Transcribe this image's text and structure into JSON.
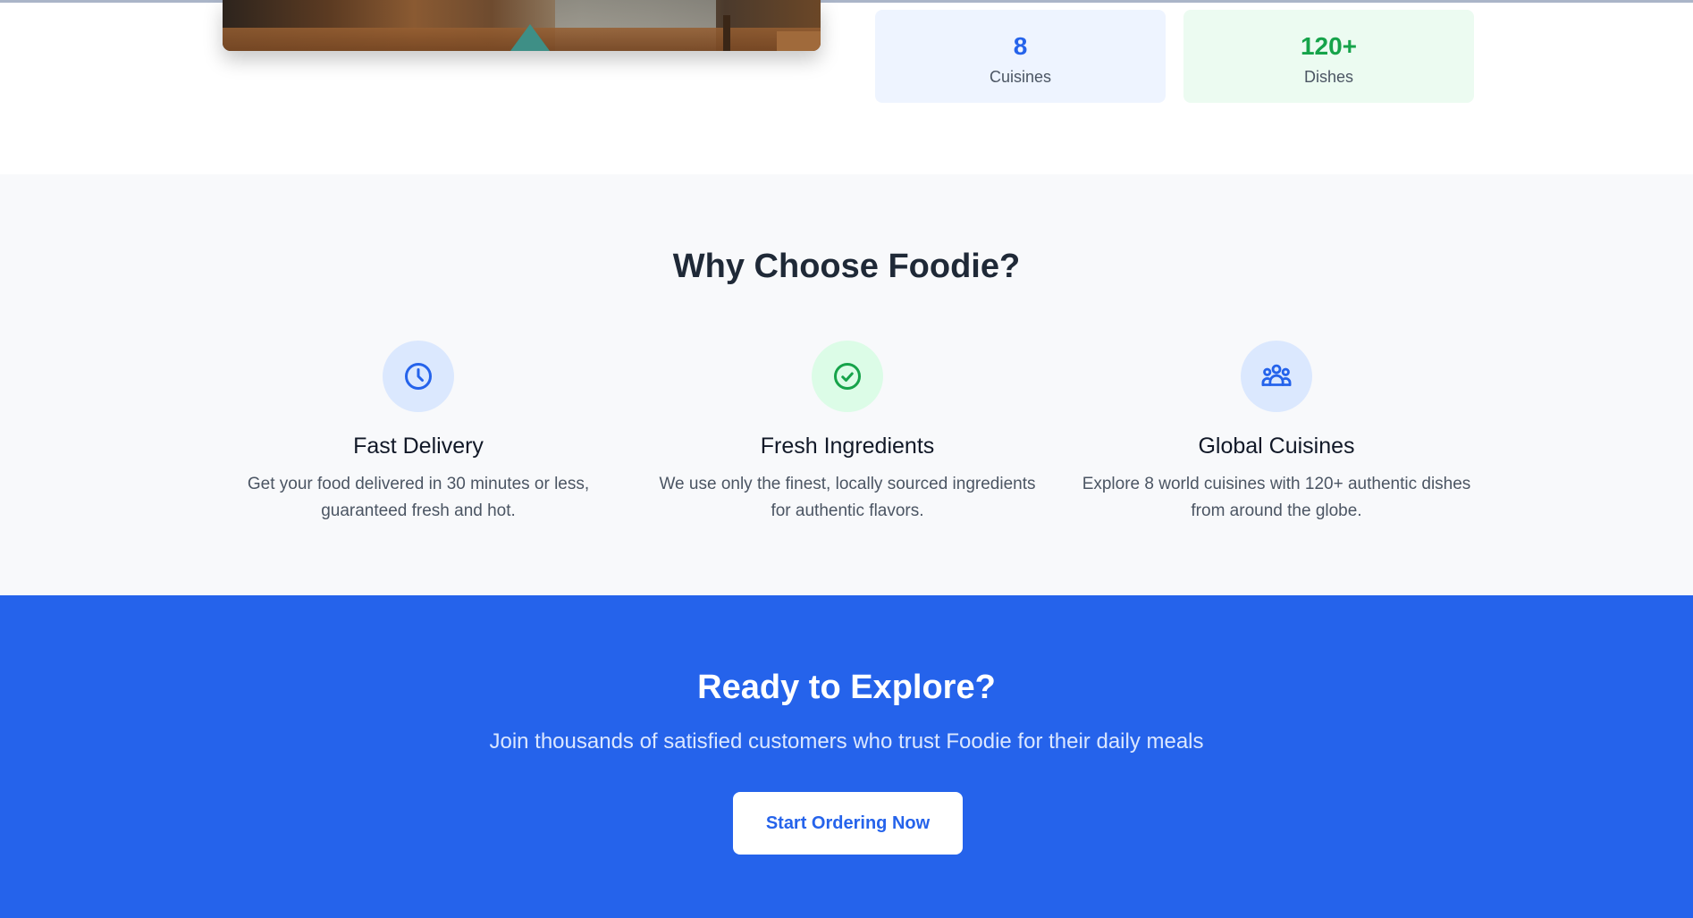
{
  "stats": [
    {
      "value": "8",
      "label": "Cuisines",
      "color": "#2563eb"
    },
    {
      "value": "120+",
      "label": "Dishes",
      "color": "#16a34a"
    }
  ],
  "why": {
    "title": "Why Choose Foodie?",
    "features": [
      {
        "icon": "clock-icon",
        "title": "Fast Delivery",
        "text": "Get your food delivered in 30 minutes or less, guaranteed fresh and hot."
      },
      {
        "icon": "check-circle-icon",
        "title": "Fresh Ingredients",
        "text": "We use only the finest, locally sourced ingredients for authentic flavors."
      },
      {
        "icon": "users-icon",
        "title": "Global Cuisines",
        "text": "Explore 8 world cuisines with 120+ authentic dishes from around the globe."
      }
    ]
  },
  "cta": {
    "title": "Ready to Explore?",
    "subtitle": "Join thousands of satisfied customers who trust Foodie for their daily meals",
    "button_label": "Start Ordering Now"
  },
  "colors": {
    "primary": "#2563eb",
    "success": "#16a34a",
    "section_bg": "#f8f9fb"
  }
}
